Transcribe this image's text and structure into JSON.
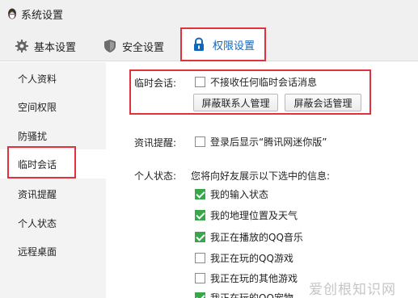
{
  "window": {
    "title": "系统设置"
  },
  "tabs": {
    "basic": "基本设置",
    "security": "安全设置",
    "permission": "权限设置"
  },
  "sidebar": {
    "items": [
      {
        "label": "个人资料"
      },
      {
        "label": "空间权限"
      },
      {
        "label": "防骚扰"
      },
      {
        "label": "临时会话"
      },
      {
        "label": "资讯提醒"
      },
      {
        "label": "个人状态"
      },
      {
        "label": "远程桌面"
      }
    ]
  },
  "temp_session": {
    "label": "临时会话:",
    "no_msg": {
      "label": "不接收任何临时会话消息",
      "checked": false
    },
    "block_contacts_button": "屏蔽联系人管理",
    "block_session_button": "屏蔽会话管理"
  },
  "news": {
    "label": "资讯提醒:",
    "show_mini": {
      "label": "登录后显示“腾讯网迷你版”",
      "checked": false
    }
  },
  "status": {
    "label": "个人状态:",
    "desc": "您将向好友展示以下选中的信息:",
    "options": [
      {
        "label": "我的输入状态",
        "checked": true
      },
      {
        "label": "我的地理位置及天气",
        "checked": true
      },
      {
        "label": "我正在播放的QQ音乐",
        "checked": true
      },
      {
        "label": "我正在玩的QQ游戏",
        "checked": false
      },
      {
        "label": "我正在玩的其他游戏",
        "checked": false
      },
      {
        "label": "我正在玩的QQ宠物",
        "checked": true
      }
    ]
  },
  "watermark": "爱创根知识网",
  "colors": {
    "highlight": "#e0323c",
    "accent": "#1466b8",
    "check": "#37a84a"
  }
}
